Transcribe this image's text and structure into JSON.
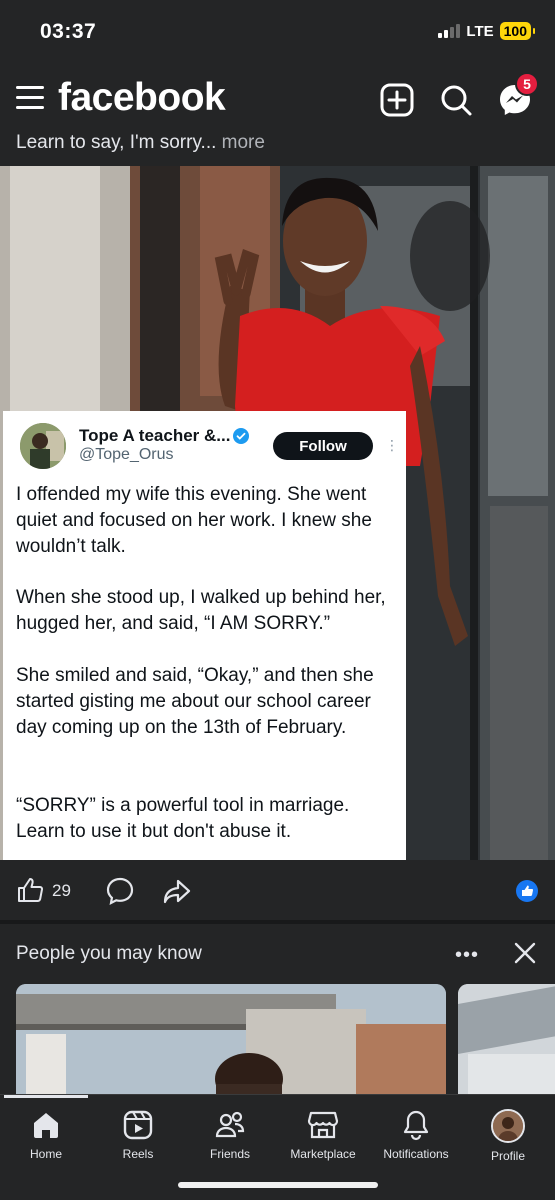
{
  "status_bar": {
    "time": "03:37",
    "network": "LTE",
    "battery": "100",
    "battery_color": "#ffd60a"
  },
  "header": {
    "logo": "facebook",
    "create_icon": "plus-square-icon",
    "search_icon": "search-icon",
    "messenger_icon": "messenger-icon",
    "messenger_badge": "5",
    "badge_color": "#e41e3f"
  },
  "post": {
    "caption": "Learn to say, I'm sorry...",
    "caption_more": " more",
    "tweet": {
      "name": "Tope A teacher &...",
      "handle": "@Tope_Orus",
      "follow_label": "Follow",
      "paragraphs": [
        "I offended my wife this evening. She went quiet and focused on her work. I knew she wouldn’t talk.",
        "When she stood up, I walked up behind her, hugged her, and said, “I AM SORRY.”",
        "She smiled and said, “Okay,” and then she started gisting me about our school career day coming up on the 13th of February.",
        "“SORRY” is a powerful tool in marriage. Learn to use it but don't abuse it."
      ]
    },
    "like_count": "29",
    "like_icon": "thumbs-up-icon",
    "comment_icon": "comment-icon",
    "share_icon": "share-icon",
    "reaction_icon": "like-reaction-icon",
    "reaction_color": "#1877f2"
  },
  "pymk": {
    "title": "People you may know",
    "more_icon": "more-dots-icon",
    "close_icon": "close-icon"
  },
  "bottom_nav": {
    "items": [
      {
        "label": "Home",
        "icon": "home-icon"
      },
      {
        "label": "Reels",
        "icon": "reels-icon"
      },
      {
        "label": "Friends",
        "icon": "friends-icon"
      },
      {
        "label": "Marketplace",
        "icon": "marketplace-icon"
      },
      {
        "label": "Notifications",
        "icon": "bell-icon"
      },
      {
        "label": "Profile",
        "icon": "profile-avatar"
      }
    ]
  }
}
